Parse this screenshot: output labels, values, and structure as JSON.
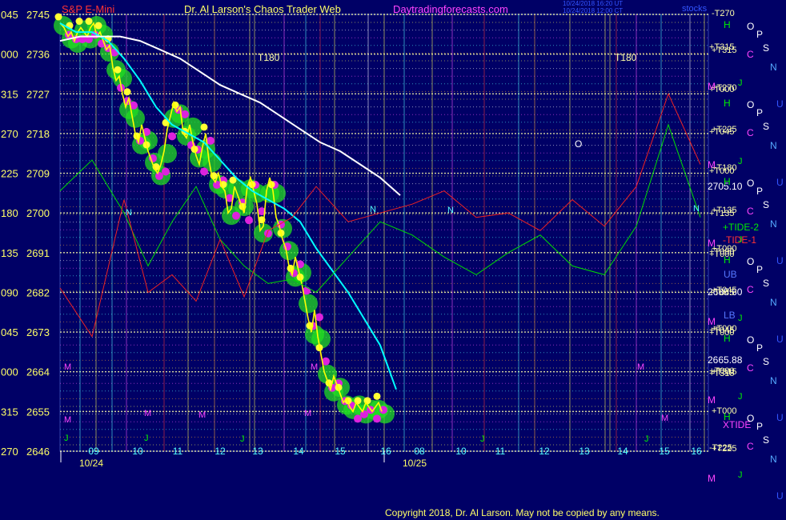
{
  "header": {
    "symbol": "S&P E-Mini",
    "site_title": "Dr. Al Larson's Chaos Trader Web",
    "site_url": "Daytradingforecasts.com",
    "timestamp_1": "10/24/2018 16:20 UT",
    "timestamp_2": "10/24/2018 12:00 CT",
    "top_right": "stocks"
  },
  "copyright": "Copyright 2018, Dr. Al Larson. May not be copied by any means.",
  "chart_data": {
    "type": "line",
    "y_axis_left": {
      "angle_ticks": [
        "045",
        "000",
        "315",
        "270",
        "225",
        "180",
        "135",
        "090",
        "045",
        "000",
        "315",
        "270"
      ],
      "price_ticks": [
        2745,
        2736,
        2727,
        2718,
        2709,
        2700,
        2691,
        2682,
        2673,
        2664,
        2655,
        2646
      ],
      "ylim": [
        2646,
        2745
      ]
    },
    "x_axis": {
      "hour_labels": [
        "09",
        "10",
        "11",
        "12",
        "13",
        "14",
        "15",
        "16",
        "08",
        "10",
        "11",
        "12",
        "13",
        "14",
        "15",
        "16"
      ],
      "date_labels": [
        "10/24",
        "10/25"
      ]
    },
    "price_annotations": [
      "2705.10",
      "2685.60",
      "2665.88"
    ],
    "right_levels": [
      "-T270",
      "+T315",
      "+T270",
      "+T225",
      "+T180",
      "+T135",
      "+T090",
      "+T045",
      "+T000",
      "+T315",
      "+T000",
      "+T225"
    ],
    "right_levels_overlap": [
      "+T315",
      "+T000",
      "+T045",
      "+T000",
      "+T135",
      "+T090",
      "+T000",
      "+T045",
      "+T045",
      "+T000",
      "+T000",
      "+T315",
      "-T225"
    ],
    "inline_labels": {
      "t180": "T180",
      "o": "O",
      "n": "N",
      "ub": "UB",
      "lb": "LB",
      "tide_plus2": "+TIDE-2",
      "tide_minus1": "-TIDE-1",
      "xtide": "XTIDE"
    },
    "planet_labels": [
      "H",
      "O",
      "P",
      "S",
      "N",
      "U",
      "C",
      "M",
      "J"
    ],
    "series": [
      {
        "name": "price",
        "color": "#ffff00",
        "x": [
          0,
          5,
          10,
          14,
          18,
          22,
          26,
          30,
          34,
          38,
          42,
          46,
          50,
          54,
          58,
          62,
          66,
          70,
          74,
          78,
          82,
          86,
          90,
          94,
          98,
          102,
          106,
          110,
          114,
          118,
          122,
          126,
          130,
          134,
          138,
          142,
          146,
          150,
          154,
          158,
          162,
          166,
          170,
          174,
          178,
          182,
          186,
          190,
          194,
          198,
          202,
          206,
          210,
          214,
          218,
          222,
          226,
          230,
          234,
          238,
          242,
          246,
          250,
          254,
          258,
          262,
          266,
          270,
          274,
          278,
          282,
          286,
          290,
          294,
          298,
          302,
          306,
          310,
          314,
          318,
          322,
          326,
          330,
          334,
          338,
          342,
          346,
          350,
          354,
          358,
          362,
          366,
          370,
          374,
          378,
          382,
          386,
          390,
          394,
          398,
          402
        ],
        "values": [
          2743,
          2742,
          2740,
          2741,
          2739,
          2741,
          2742,
          2741,
          2740,
          2742,
          2743,
          2740,
          2741,
          2739,
          2737,
          2738,
          2733,
          2730,
          2731,
          2727,
          2724,
          2726,
          2722,
          2718,
          2716,
          2720,
          2717,
          2714,
          2712,
          2710,
          2709,
          2711,
          2714,
          2719,
          2722,
          2725,
          2723,
          2724,
          2718,
          2717,
          2720,
          2716,
          2713,
          2711,
          2715,
          2718,
          2712,
          2708,
          2707,
          2709,
          2706,
          2705,
          2700,
          2701,
          2706,
          2704,
          2702,
          2700,
          2706,
          2708,
          2705,
          2702,
          2696,
          2697,
          2705,
          2708,
          2705,
          2699,
          2697,
          2694,
          2692,
          2688,
          2686,
          2690,
          2687,
          2684,
          2680,
          2676,
          2673,
          2678,
          2672,
          2668,
          2664,
          2662,
          2660,
          2663,
          2661,
          2659,
          2657,
          2658,
          2656,
          2655,
          2657,
          2656,
          2655,
          2657,
          2656,
          2655,
          2656,
          2657,
          2655
        ]
      },
      {
        "name": "fast-ma",
        "color": "#00ffff",
        "x": [
          0,
          20,
          40,
          60,
          80,
          100,
          120,
          140,
          160,
          180,
          200,
          220,
          240,
          260,
          280,
          300,
          320,
          340,
          360,
          380,
          400,
          420
        ],
        "values": [
          2743,
          2741,
          2741,
          2739,
          2735,
          2730,
          2724,
          2720,
          2718,
          2716,
          2712,
          2708,
          2705,
          2703,
          2701,
          2698,
          2692,
          2687,
          2682,
          2676,
          2670,
          2660
        ]
      },
      {
        "name": "slow-ma",
        "color": "#ffffff",
        "x": [
          0,
          25,
          50,
          75,
          100,
          125,
          150,
          175,
          200,
          225,
          250,
          275,
          300,
          325,
          350,
          375,
          400,
          425
        ],
        "values": [
          2739,
          2740,
          2740,
          2740,
          2739,
          2737,
          2735,
          2732,
          2729,
          2727,
          2725,
          2722,
          2719,
          2716,
          2714,
          2711,
          2708,
          2704
        ]
      },
      {
        "name": "tide-green",
        "color": "#00dd00",
        "x": [
          0,
          40,
          80,
          110,
          140,
          170,
          200,
          230,
          260,
          290,
          320,
          360,
          400,
          440,
          480,
          520,
          560,
          600,
          640,
          680,
          720,
          760,
          800
        ],
        "values": [
          2705,
          2712,
          2700,
          2688,
          2698,
          2706,
          2694,
          2688,
          2684,
          2685,
          2682,
          2690,
          2698,
          2695,
          2690,
          2686,
          2691,
          2695,
          2688,
          2686,
          2697,
          2720,
          2699
        ]
      },
      {
        "name": "tide-red",
        "color": "#ee2222",
        "x": [
          0,
          40,
          80,
          110,
          140,
          170,
          200,
          230,
          260,
          290,
          320,
          360,
          400,
          440,
          480,
          520,
          560,
          600,
          640,
          680,
          720,
          760,
          800
        ],
        "values": [
          2683,
          2672,
          2703,
          2682,
          2686,
          2680,
          2694,
          2681,
          2696,
          2699,
          2706,
          2698,
          2700,
          2702,
          2705,
          2699,
          2700,
          2696,
          2703,
          2697,
          2706,
          2727,
          2711
        ]
      }
    ]
  }
}
